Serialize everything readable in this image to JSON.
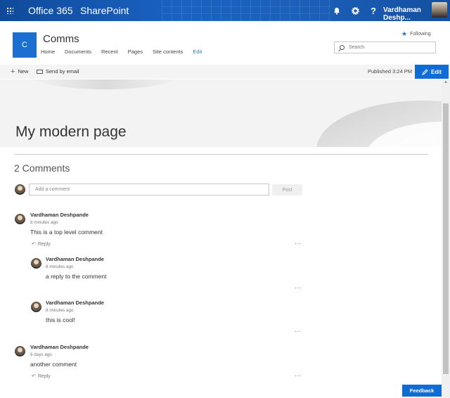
{
  "suite": {
    "title": "Office 365",
    "app": "SharePoint",
    "user": "Vardhaman Deshp..."
  },
  "site": {
    "logo_letter": "C",
    "title": "Comms",
    "nav": [
      "Home",
      "Documents",
      "Recent",
      "Pages",
      "Site contents",
      "Edit"
    ],
    "following": "Following",
    "search_placeholder": "Search"
  },
  "commandbar": {
    "new": "New",
    "send_email": "Send by email",
    "published": "Published 3:24 PM",
    "edit": "Edit"
  },
  "page": {
    "title": "My modern page"
  },
  "comments": {
    "count_label": "2 Comments",
    "add_placeholder": "Add a comment",
    "post": "Post",
    "reply_label": "Reply",
    "more": "···",
    "items": [
      {
        "author": "Vardhaman Deshpande",
        "time": "8 minutes ago",
        "text": "This is a top level comment"
      },
      {
        "author": "Vardhaman Deshpande",
        "time": "8 minutes ago",
        "text": "a reply to the comment"
      },
      {
        "author": "Vardhaman Deshpande",
        "time": "8 minutes ago",
        "text": "this is cool!"
      },
      {
        "author": "Vardhaman Deshpande",
        "time": "6 days ago",
        "text": "another comment"
      }
    ]
  },
  "feedback": "Feedback"
}
